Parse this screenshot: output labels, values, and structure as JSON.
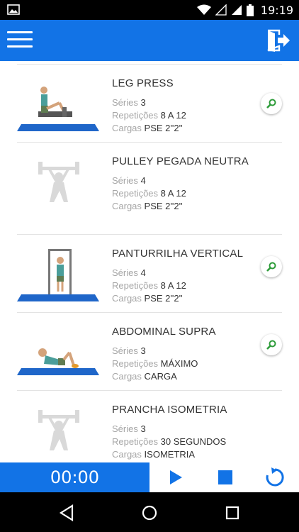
{
  "status_bar": {
    "time": "19:19"
  },
  "app_bar": {
    "accent": "#1273e6"
  },
  "labels": {
    "series": "Séries",
    "reps": "Repetições",
    "loads": "Cargas"
  },
  "exercises": [
    {
      "name": "LEG PRESS",
      "series": "3",
      "reps": "8 A 12",
      "loads": "PSE 2''2''",
      "image": "leg-press",
      "has_zoom": true
    },
    {
      "name": "PULLEY PEGADA NEUTRA",
      "series": "4",
      "reps": "8 A 12",
      "loads": "PSE 2''2''",
      "image": "placeholder",
      "has_zoom": false
    },
    {
      "name": "PANTURRILHA VERTICAL",
      "series": "4",
      "reps": "8 A 12",
      "loads": "PSE 2''2''",
      "image": "calf-raise",
      "has_zoom": true
    },
    {
      "name": "ABDOMINAL SUPRA",
      "series": "3",
      "reps": "MÁXIMO",
      "loads": "CARGA",
      "image": "crunch",
      "has_zoom": true
    },
    {
      "name": "PRANCHA ISOMETRIA",
      "series": "3",
      "reps": "30 SEGUNDOS",
      "loads": "ISOMETRIA",
      "image": "placeholder",
      "has_zoom": false
    }
  ],
  "timer": {
    "display": "00:00"
  },
  "controls": {
    "play": "play-icon",
    "stop": "stop-icon",
    "reset": "refresh-icon"
  },
  "icons": {
    "menu": "hamburger-menu-icon",
    "exit": "exit-door-icon",
    "zoom": "magnifier-icon"
  }
}
